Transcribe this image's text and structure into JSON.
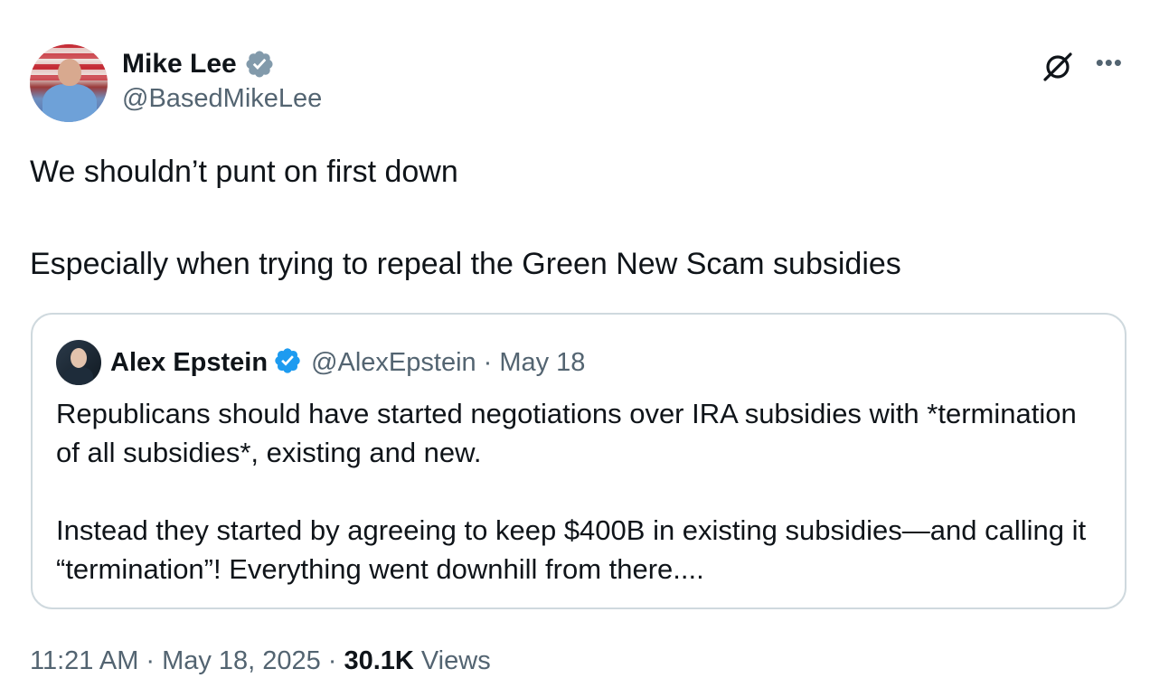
{
  "author": {
    "display_name": "Mike Lee",
    "handle": "@BasedMikeLee",
    "badge": "gray-verified-icon"
  },
  "tweet": {
    "paragraphs": [
      "We shouldn’t punt on first down",
      "Especially when trying to repeal the Green New Scam subsidies"
    ]
  },
  "quoted_tweet": {
    "display_name": "Alex Epstein",
    "handle": "@AlexEpstein",
    "separator": "·",
    "date": "May 18",
    "badge": "blue-verified-icon",
    "paragraphs": [
      "Republicans should have started negotiations over IRA subsidies with *termination of all subsidies*, existing and new.",
      "Instead they started by agreeing to keep $400B in existing subsidies—and calling it “termination”! Everything went downhill from there...."
    ]
  },
  "footer": {
    "time": "11:21 AM",
    "sep1": "·",
    "date": "May 18, 2025",
    "sep2": "·",
    "views_count": "30.1K",
    "views_label": "Views"
  },
  "icons": {
    "grok": "grok-icon",
    "more": "more-icon"
  },
  "colors": {
    "text_primary": "#0f1419",
    "text_secondary": "#536471",
    "border": "#cfd9de",
    "verified_blue": "#1d9bf0",
    "verified_gray": "#829aab"
  }
}
